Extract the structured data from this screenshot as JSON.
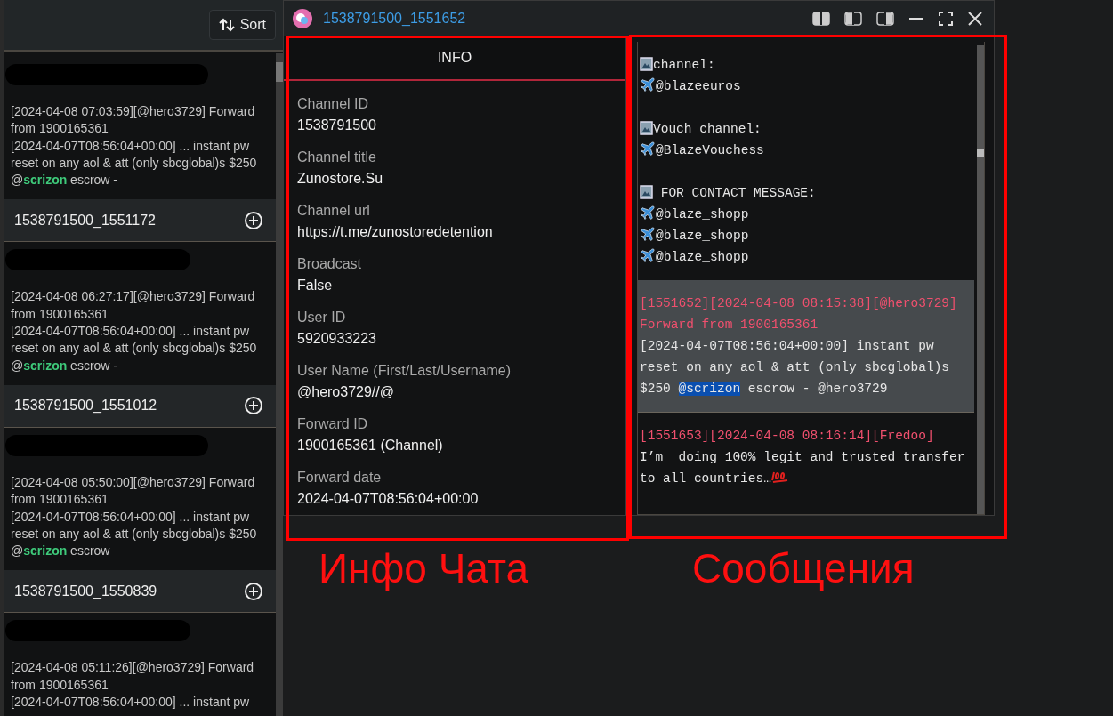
{
  "sidebar": {
    "sort_button": "Sort",
    "entries": [
      {
        "preview": "[2024-04-08 07:03:59][@hero3729] Forward from 1900165361\n[2024-04-07T08:56:04+00:00] ... instant pw reset on any aol & att (only sbcglobal)s $250 @**scrizon** escrow -",
        "id": "1538791500_1551172"
      },
      {
        "preview": "[2024-04-08 06:27:17][@hero3729] Forward from 1900165361\n[2024-04-07T08:56:04+00:00] ... instant pw reset on any aol & att (only sbcglobal)s $250 @**scrizon** escrow -",
        "id": "1538791500_1551012"
      },
      {
        "preview": "[2024-04-08 05:50:00][@hero3729] Forward from 1900165361\n[2024-04-07T08:56:04+00:00] ... instant pw reset on any aol & att (only sbcglobal)s $250 @**scrizon** escrow",
        "id": "1538791500_1550839"
      },
      {
        "preview": "[2024-04-08 05:11:26][@hero3729] Forward from 1900165361\n[2024-04-07T08:56:04+00:00] ... instant pw"
      }
    ]
  },
  "window": {
    "title": "1538791500_1551652"
  },
  "info": {
    "tab": {
      "label": "INFO",
      "selected": true
    },
    "fields": [
      {
        "label": "Channel ID",
        "value": "1538791500"
      },
      {
        "label": "Channel title",
        "value": "Zunostore.Su"
      },
      {
        "label": "Channel url",
        "value": "https://t.me/zunostoredetention"
      },
      {
        "label": "Broadcast",
        "value": "False"
      },
      {
        "label": "User ID",
        "value": "5920933223"
      },
      {
        "label": "User Name (First/Last/Username)",
        "value": "@hero3729//@"
      },
      {
        "label": "Forward ID",
        "value": "1900165361 (Channel)"
      },
      {
        "label": "Forward date",
        "value": "2024-04-07T08:56:04+00:00"
      }
    ]
  },
  "messages": [
    {
      "selected": false,
      "lines": [
        {
          "kind": "frame",
          "text": "channel:"
        },
        {
          "kind": "plane",
          "text": "@blazeeuros"
        },
        {
          "kind": "blank"
        },
        {
          "kind": "frame",
          "text": "Vouch channel:"
        },
        {
          "kind": "plane",
          "text": "@BlazeVouchess"
        },
        {
          "kind": "blank"
        },
        {
          "kind": "frame",
          "text": " FOR CONTACT MESSAGE:"
        },
        {
          "kind": "plane",
          "text": "@blaze_shopp"
        },
        {
          "kind": "plane",
          "text": "@blaze_shopp"
        },
        {
          "kind": "plane",
          "text": "@blaze_shopp"
        }
      ]
    },
    {
      "selected": true,
      "header": "[1551652][2024-04-08 08:15:38][@hero3729] Forward from 1900165361",
      "lines": [
        {
          "kind": "plain",
          "text": "[2024-04-07T08:56:04+00:00] instant pw reset on any aol & att (only sbcglobal)s $250 **@scrizon** escrow - @hero3729"
        }
      ]
    },
    {
      "selected": false,
      "header": "[1551653][2024-04-08 08:16:14][Fredoo]",
      "lines": [
        {
          "kind": "plain",
          "text": "I’m  doing 100% legit and trusted transfer"
        },
        {
          "kind": "hundred",
          "text": "to all countries…"
        }
      ]
    }
  ],
  "annotations": [
    "Инфо Чата",
    "Сообщения"
  ]
}
